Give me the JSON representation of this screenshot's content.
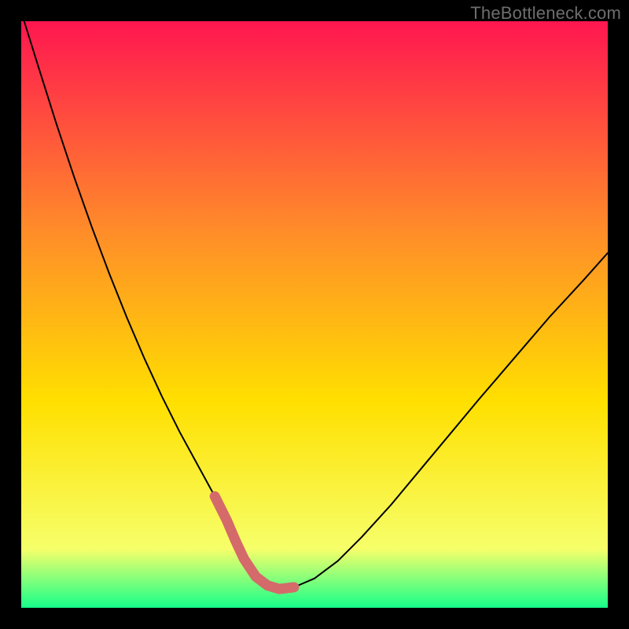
{
  "watermark": "TheBottleneck.com",
  "chart_data": {
    "type": "line",
    "title": "",
    "xlabel": "",
    "ylabel": "",
    "xlim": [
      0,
      100
    ],
    "ylim": [
      0,
      100
    ],
    "grid": false,
    "legend": false,
    "background_gradient": {
      "top_color": "#ff1650",
      "mid_color": "#ffe000",
      "bottom_color": "#16ff8a"
    },
    "series": [
      {
        "name": "bottleneck-curve",
        "color": "#000000",
        "stroke_width": 2,
        "x": [
          0.5,
          3,
          6,
          9,
          12,
          15,
          18,
          21,
          24,
          27,
          30,
          33,
          35,
          36.5,
          38,
          40,
          42,
          44,
          46.5,
          50,
          54,
          58,
          63,
          68,
          73,
          78,
          84,
          90,
          96,
          100
        ],
        "values": [
          100,
          92,
          82.5,
          73.5,
          65,
          57,
          49.5,
          42.5,
          36,
          30,
          24.5,
          19,
          15,
          11.5,
          8.3,
          5.3,
          3.8,
          3.2,
          3.5,
          5.0,
          8.0,
          12.0,
          17.5,
          23.5,
          29.5,
          35.5,
          42.5,
          49.5,
          56,
          60.5
        ]
      },
      {
        "name": "optimal-zone-marker",
        "color": "#d46a6a",
        "stroke_width": 13,
        "linecap": "round",
        "x": [
          33,
          35,
          36.5,
          38,
          40,
          42,
          44,
          46.5
        ],
        "values": [
          19,
          15,
          11.5,
          8.3,
          5.3,
          3.8,
          3.2,
          3.5
        ]
      }
    ]
  }
}
